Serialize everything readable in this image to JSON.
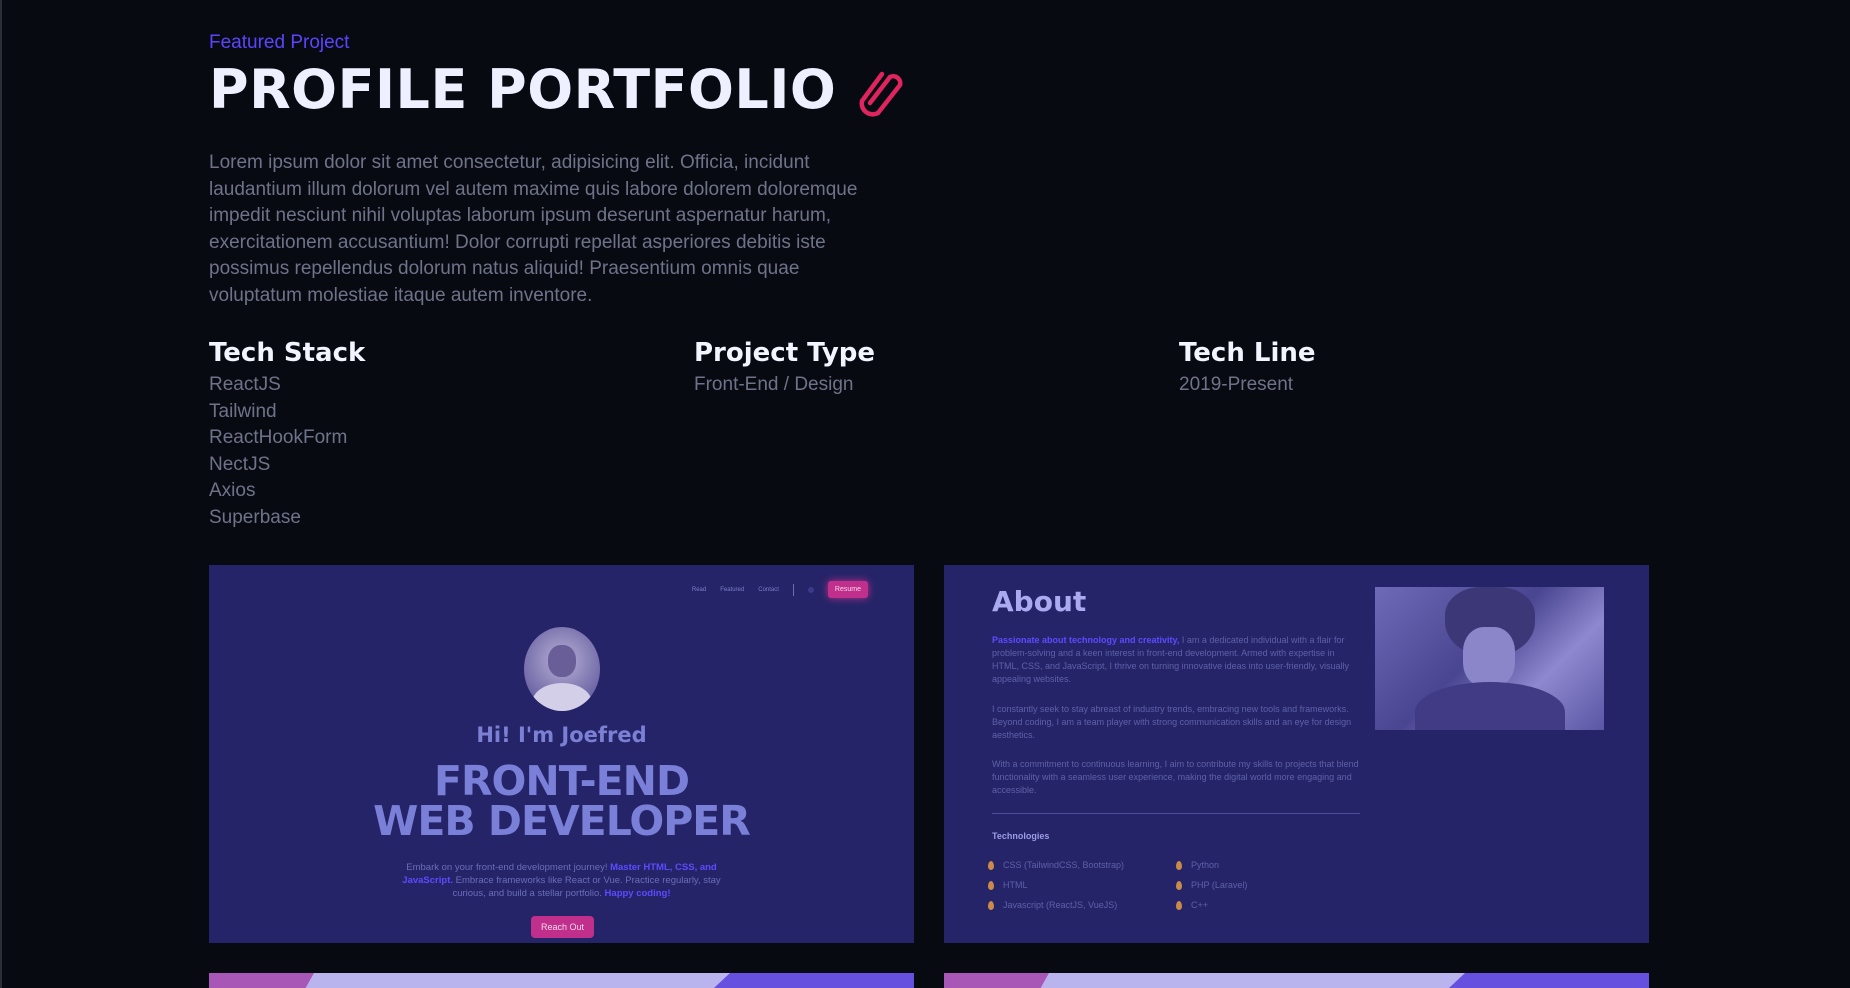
{
  "header": {
    "eyebrow": "Featured Project",
    "title": "PROFILE PORTFOLIO",
    "title_icon": "paperclip-icon",
    "description": "Lorem ipsum dolor sit amet consectetur, adipisicing elit. Officia, incidunt laudantium illum dolorum vel autem maxime quis labore dolorem doloremque impedit nesciunt nihil voluptas laborum ipsum deserunt aspernatur harum, exercitationem accusantium! Dolor corrupti repellat asperiores debitis iste possimus repellendus dolorum natus aliquid! Praesentium omnis quae voluptatum molestiae itaque autem inventore."
  },
  "details": {
    "tech_stack": {
      "heading": "Tech Stack",
      "items": [
        "ReactJS",
        "Tailwind",
        "ReactHookForm",
        "NectJS",
        "Axios",
        "Superbase"
      ]
    },
    "project_type": {
      "heading": "Project Type",
      "value": "Front-End / Design"
    },
    "tech_line": {
      "heading": "Tech Line",
      "value": "2019-Present"
    }
  },
  "preview_home": {
    "nav": [
      "Read",
      "Featured",
      "Contact"
    ],
    "resume": "Resume",
    "greeting": "Hi! I'm Joefred",
    "headline_1": "FRONT-END",
    "headline_2": "WEB DEVELOPER",
    "blurb_1": "Embark on your front-end development journey!",
    "blurb_bold_1": "Master HTML, CSS, and JavaScript.",
    "blurb_2": "Embrace frameworks like React or Vue. Practice regularly, stay curious, and build a stellar portfolio.",
    "blurb_bold_2": "Happy coding!",
    "cta": "Reach Out"
  },
  "preview_about": {
    "heading": "About",
    "p1_bold": "Passionate about technology and creativity,",
    "p1": "I am a dedicated individual with a flair for problem-solving and a keen interest in front-end development. Armed with expertise in HTML, CSS, and JavaScript, I thrive on turning innovative ideas into user-friendly, visually appealing websites.",
    "p2": "I constantly seek to stay abreast of industry trends, embracing new tools and frameworks. Beyond coding, I am a team player with strong communication skills and an eye for design aesthetics.",
    "p3": "With a commitment to continuous learning, I aim to contribute my skills to projects that blend functionality with a seamless user experience, making the digital world more engaging and accessible.",
    "tech_heading": "Technologies",
    "tech_left": [
      "CSS (TailwindCSS, Bootstrap)",
      "HTML",
      "Javascript (ReactJS, VueJS)"
    ],
    "tech_right": [
      "Python",
      "PHP (Laravel)",
      "C++"
    ]
  },
  "colors": {
    "background": "#080a12",
    "accent": "#5a45ff",
    "pink": "#e0245e",
    "preview_bg": "#252468"
  }
}
